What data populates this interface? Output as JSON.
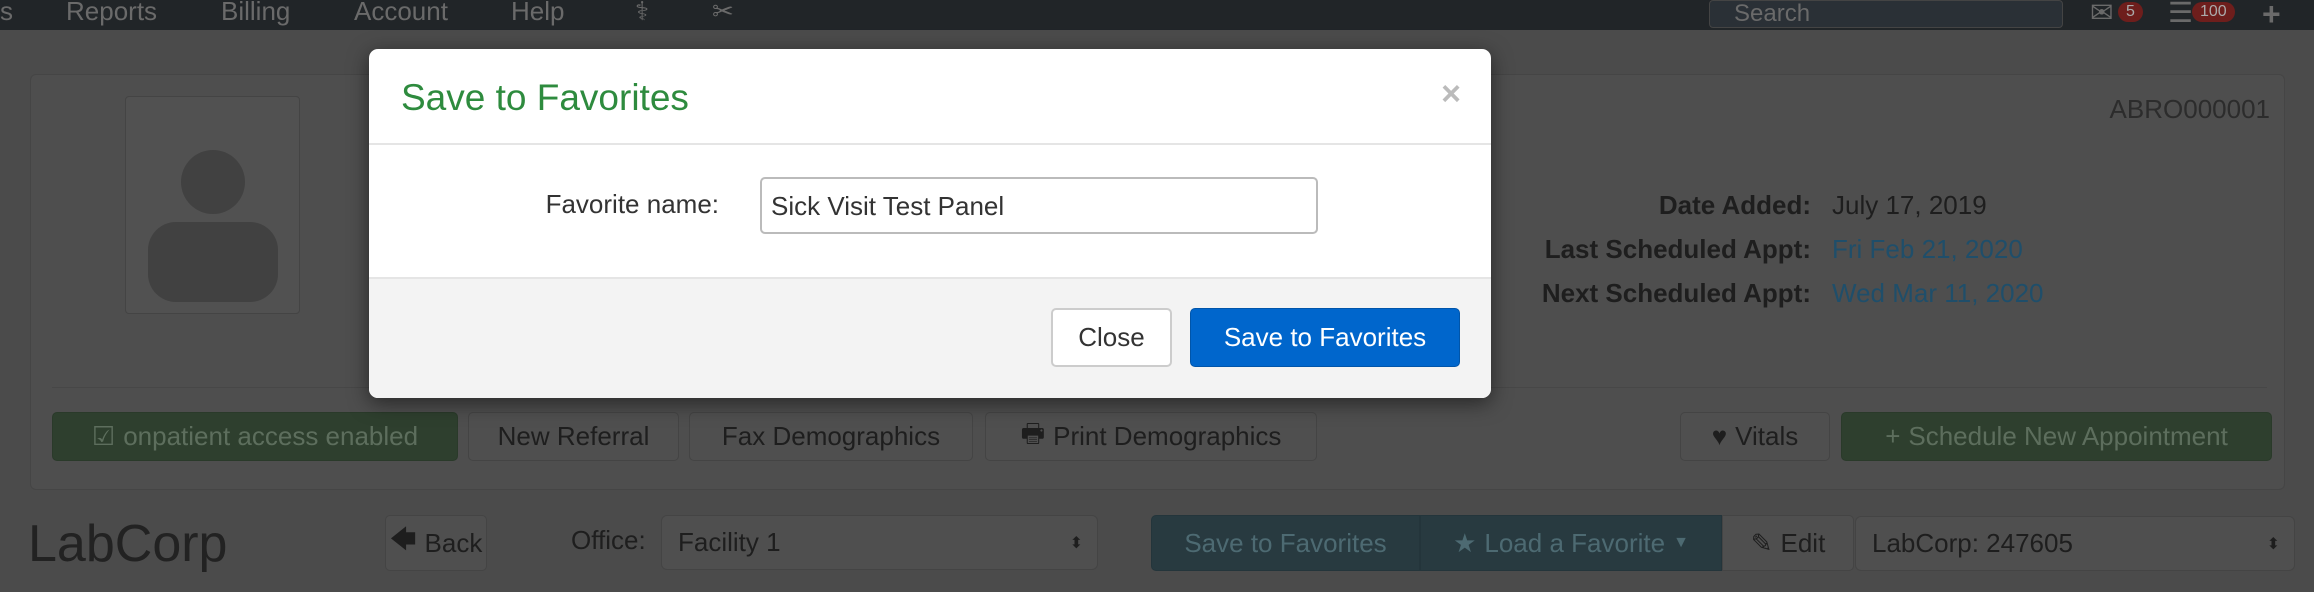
{
  "navbar": {
    "items": [
      "s",
      "Reports",
      "Billing",
      "Account",
      "Help"
    ],
    "icons": [
      "caduceus-icon",
      "scissors-icon"
    ],
    "search_placeholder": "Search",
    "messages_badge": "5",
    "tasks_badge": "100"
  },
  "patient": {
    "id": "ABRO000001",
    "date_added_label": "Date Added:",
    "date_added": "July 17, 2019",
    "last_appt_label": "Last Scheduled Appt:",
    "last_appt": "Fri Feb 21, 2020",
    "next_appt_label": "Next Scheduled Appt:",
    "next_appt": "Wed Mar 11, 2020",
    "buttons": {
      "onpatient": "onpatient access enabled",
      "new_referral": "New Referral",
      "fax": "Fax Demographics",
      "print": "Print Demographics",
      "vitals": "Vitals",
      "schedule": "Schedule New Appointment"
    }
  },
  "lab": {
    "title": "LabCorp",
    "back": "Back",
    "office_label": "Office:",
    "office_value": "Facility 1",
    "save_fav": "Save to Favorites",
    "load_fav": "Load a Favorite",
    "edit": "Edit",
    "lab_select": "LabCorp: 247605"
  },
  "modal": {
    "title": "Save to Favorites",
    "close_x": "×",
    "field_label": "Favorite name:",
    "field_value": "Sick Visit Test Panel",
    "close_button": "Close",
    "save_button": "Save to Favorites"
  },
  "colors": {
    "modal_title": "#2e8b3e",
    "primary": "#0066cc",
    "link": "#337ab7",
    "success": "#5cb85c",
    "info": "#5bc0de"
  }
}
